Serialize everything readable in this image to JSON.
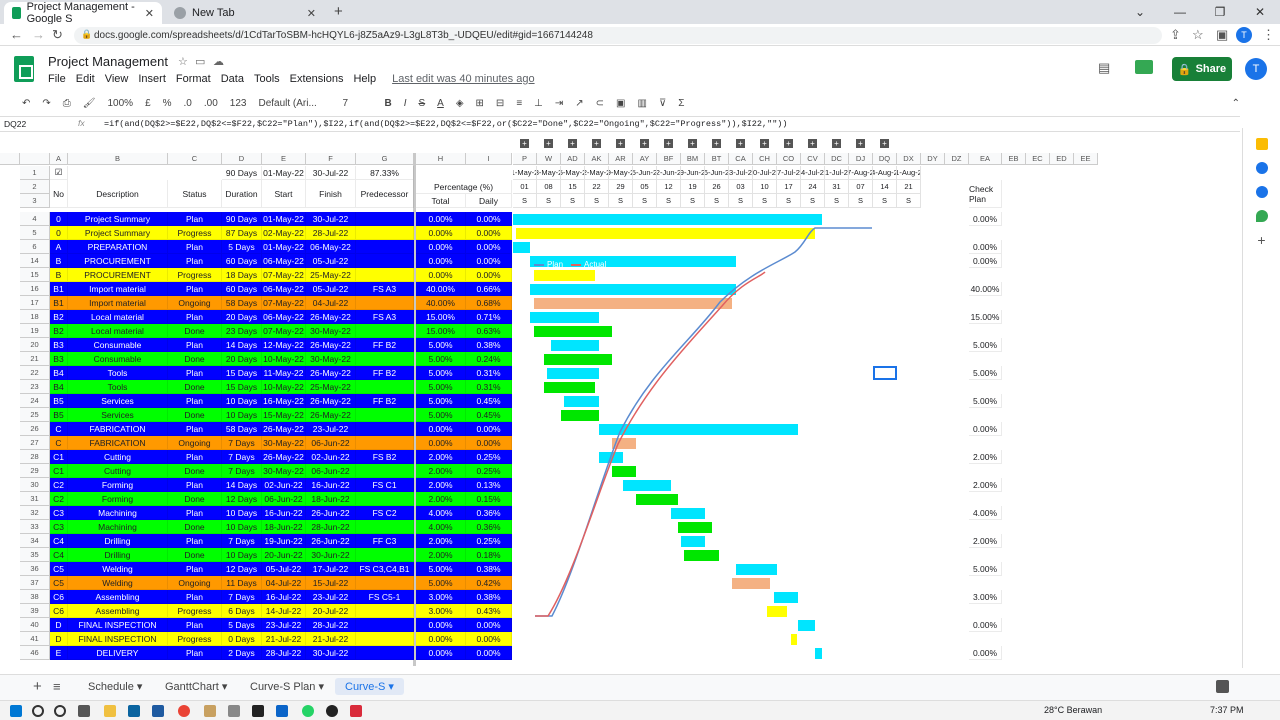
{
  "browser": {
    "tabs": [
      {
        "title": "Project Management - Google S",
        "active": true
      },
      {
        "title": "New Tab",
        "active": false
      }
    ],
    "url": "docs.google.com/spreadsheets/d/1CdTarToSBM-hcHQYL6-j8Z5aAz9-L3gL8T3b_-UDQEU/edit#gid=1667144248"
  },
  "sheet": {
    "title": "Project Management",
    "menu": [
      "File",
      "Edit",
      "View",
      "Insert",
      "Format",
      "Data",
      "Tools",
      "Extensions",
      "Help"
    ],
    "last_edit": "Last edit was 40 minutes ago",
    "share_label": "Share",
    "avatar_letter": "T",
    "toolbar": {
      "zoom": "100%",
      "currency": "£",
      "percent": "%",
      "dec_minus": ".0",
      "dec_plus": ".00",
      "format": "123",
      "font": "Default (Ari...",
      "size": "7"
    },
    "name_box": "DQ22",
    "formula": "=if(and(DQ$2>=$E22,DQ$2<=$F22,$C22=\"Plan\"),$I22,if(and(DQ$2>=$E22,DQ$2<=$F22,or($C22=\"Done\",$C22=\"Ongoing\",$C22=\"Progress\")),$I22,\"\"))"
  },
  "columns": [
    "A",
    "B",
    "C",
    "D",
    "E",
    "F",
    "G",
    "H",
    "I",
    "P",
    "W",
    "AD",
    "AK",
    "AR",
    "AY",
    "BF",
    "BM",
    "BT",
    "CA",
    "CH",
    "CO",
    "CV",
    "DC",
    "DJ",
    "DQ",
    "DX",
    "DY",
    "DZ",
    "EA",
    "EB",
    "EC",
    "ED",
    "EE"
  ],
  "header_rows": {
    "row1": {
      "total_duration": "90 Days",
      "start": "01-May-22",
      "finish": "30-Jul-22",
      "pct": "87.33%"
    },
    "row2": {
      "no": "No",
      "description": "Description",
      "status": "Status",
      "duration": "Duration",
      "start": "Start",
      "finish": "Finish",
      "predecessor": "Predecessor",
      "percentage": "Percentage (%)",
      "check": "Check Plan"
    },
    "row3": {
      "total": "Total",
      "daily": "Daily"
    },
    "timeline_dates": [
      "1-May-2",
      "3-May-2",
      "5-May-2",
      "2-May-2",
      "9-May-2",
      "5-Jun-2",
      "2-Jun-2",
      "9-Jun-2",
      "6-Jun-2",
      "3-Jul-2",
      "0-Jul-2",
      "7-Jul-2",
      "4-Jul-2",
      "1-Jul-2",
      "7-Aug-2",
      "4-Aug-2",
      "1-Aug-2"
    ],
    "timeline_days": [
      "01",
      "08",
      "15",
      "22",
      "29",
      "05",
      "12",
      "19",
      "26",
      "03",
      "10",
      "17",
      "24",
      "31",
      "07",
      "14",
      "21"
    ],
    "timeline_S": "S"
  },
  "rows": [
    {
      "rn": "4",
      "no": "0",
      "desc": "Project Summary",
      "status": "Plan",
      "dur": "90 Days",
      "start": "01-May-22",
      "finish": "30-Jul-22",
      "pred": "",
      "total": "0.00%",
      "daily": "0.00%",
      "check": "0.00%",
      "type": "plan"
    },
    {
      "rn": "5",
      "no": "0",
      "desc": "Project Summary",
      "status": "Progress",
      "dur": "87 Days",
      "start": "02-May-22",
      "finish": "28-Jul-22",
      "pred": "",
      "total": "0.00%",
      "daily": "0.00%",
      "check": "",
      "type": "progress"
    },
    {
      "rn": "6",
      "no": "A",
      "desc": "PREPARATION",
      "status": "Plan",
      "dur": "5 Days",
      "start": "01-May-22",
      "finish": "06-May-22",
      "pred": "",
      "total": "0.00%",
      "daily": "0.00%",
      "check": "0.00%",
      "type": "plan"
    },
    {
      "rn": "14",
      "no": "B",
      "desc": "PROCUREMENT",
      "status": "Plan",
      "dur": "60 Days",
      "start": "06-May-22",
      "finish": "05-Jul-22",
      "pred": "",
      "total": "0.00%",
      "daily": "0.00%",
      "check": "0.00%",
      "type": "plan"
    },
    {
      "rn": "15",
      "no": "B",
      "desc": "PROCUREMENT",
      "status": "Progress",
      "dur": "18 Days",
      "start": "07-May-22",
      "finish": "25-May-22",
      "pred": "",
      "total": "0.00%",
      "daily": "0.00%",
      "check": "",
      "type": "progress"
    },
    {
      "rn": "16",
      "no": "B1",
      "desc": "Import material",
      "status": "Plan",
      "dur": "60 Days",
      "start": "06-May-22",
      "finish": "05-Jul-22",
      "pred": "FS A3",
      "total": "40.00%",
      "daily": "0.66%",
      "check": "40.00%",
      "type": "plan"
    },
    {
      "rn": "17",
      "no": "B1",
      "desc": "Import material",
      "status": "Ongoing",
      "dur": "58 Days",
      "start": "07-May-22",
      "finish": "04-Jul-22",
      "pred": "",
      "total": "40.00%",
      "daily": "0.68%",
      "check": "",
      "type": "ongoing"
    },
    {
      "rn": "18",
      "no": "B2",
      "desc": "Local material",
      "status": "Plan",
      "dur": "20 Days",
      "start": "06-May-22",
      "finish": "26-May-22",
      "pred": "FS A3",
      "total": "15.00%",
      "daily": "0.71%",
      "check": "15.00%",
      "type": "plan"
    },
    {
      "rn": "19",
      "no": "B2",
      "desc": "Local material",
      "status": "Done",
      "dur": "23 Days",
      "start": "07-May-22",
      "finish": "30-May-22",
      "pred": "",
      "total": "15.00%",
      "daily": "0.63%",
      "check": "",
      "type": "done"
    },
    {
      "rn": "20",
      "no": "B3",
      "desc": "Consumable",
      "status": "Plan",
      "dur": "14 Days",
      "start": "12-May-22",
      "finish": "26-May-22",
      "pred": "FF B2",
      "total": "5.00%",
      "daily": "0.38%",
      "check": "5.00%",
      "type": "plan"
    },
    {
      "rn": "21",
      "no": "B3",
      "desc": "Consumable",
      "status": "Done",
      "dur": "20 Days",
      "start": "10-May-22",
      "finish": "30-May-22",
      "pred": "",
      "total": "5.00%",
      "daily": "0.24%",
      "check": "",
      "type": "done"
    },
    {
      "rn": "22",
      "no": "B4",
      "desc": "Tools",
      "status": "Plan",
      "dur": "15 Days",
      "start": "11-May-22",
      "finish": "26-May-22",
      "pred": "FF B2",
      "total": "5.00%",
      "daily": "0.31%",
      "check": "5.00%",
      "type": "plan"
    },
    {
      "rn": "23",
      "no": "B4",
      "desc": "Tools",
      "status": "Done",
      "dur": "15 Days",
      "start": "10-May-22",
      "finish": "25-May-22",
      "pred": "",
      "total": "5.00%",
      "daily": "0.31%",
      "check": "",
      "type": "done"
    },
    {
      "rn": "24",
      "no": "B5",
      "desc": "Services",
      "status": "Plan",
      "dur": "10 Days",
      "start": "16-May-22",
      "finish": "26-May-22",
      "pred": "FF B2",
      "total": "5.00%",
      "daily": "0.45%",
      "check": "5.00%",
      "type": "plan"
    },
    {
      "rn": "25",
      "no": "B5",
      "desc": "Services",
      "status": "Done",
      "dur": "10 Days",
      "start": "15-May-22",
      "finish": "26-May-22",
      "pred": "",
      "total": "5.00%",
      "daily": "0.45%",
      "check": "",
      "type": "done"
    },
    {
      "rn": "26",
      "no": "C",
      "desc": "FABRICATION",
      "status": "Plan",
      "dur": "58 Days",
      "start": "26-May-22",
      "finish": "23-Jul-22",
      "pred": "",
      "total": "0.00%",
      "daily": "0.00%",
      "check": "0.00%",
      "type": "plan"
    },
    {
      "rn": "27",
      "no": "C",
      "desc": "FABRICATION",
      "status": "Ongoing",
      "dur": "7 Days",
      "start": "30-May-22",
      "finish": "06-Jun-22",
      "pred": "",
      "total": "0.00%",
      "daily": "0.00%",
      "check": "",
      "type": "ongoing"
    },
    {
      "rn": "28",
      "no": "C1",
      "desc": "Cutting",
      "status": "Plan",
      "dur": "7 Days",
      "start": "26-May-22",
      "finish": "02-Jun-22",
      "pred": "FS B2",
      "total": "2.00%",
      "daily": "0.25%",
      "check": "2.00%",
      "type": "plan"
    },
    {
      "rn": "29",
      "no": "C1",
      "desc": "Cutting",
      "status": "Done",
      "dur": "7 Days",
      "start": "30-May-22",
      "finish": "06-Jun-22",
      "pred": "",
      "total": "2.00%",
      "daily": "0.25%",
      "check": "",
      "type": "done"
    },
    {
      "rn": "30",
      "no": "C2",
      "desc": "Forming",
      "status": "Plan",
      "dur": "14 Days",
      "start": "02-Jun-22",
      "finish": "16-Jun-22",
      "pred": "FS C1",
      "total": "2.00%",
      "daily": "0.13%",
      "check": "2.00%",
      "type": "plan"
    },
    {
      "rn": "31",
      "no": "C2",
      "desc": "Forming",
      "status": "Done",
      "dur": "12 Days",
      "start": "06-Jun-22",
      "finish": "18-Jun-22",
      "pred": "",
      "total": "2.00%",
      "daily": "0.15%",
      "check": "",
      "type": "done"
    },
    {
      "rn": "32",
      "no": "C3",
      "desc": "Machining",
      "status": "Plan",
      "dur": "10 Days",
      "start": "16-Jun-22",
      "finish": "26-Jun-22",
      "pred": "FS C2",
      "total": "4.00%",
      "daily": "0.36%",
      "check": "4.00%",
      "type": "plan"
    },
    {
      "rn": "33",
      "no": "C3",
      "desc": "Machining",
      "status": "Done",
      "dur": "10 Days",
      "start": "18-Jun-22",
      "finish": "28-Jun-22",
      "pred": "",
      "total": "4.00%",
      "daily": "0.36%",
      "check": "",
      "type": "done"
    },
    {
      "rn": "34",
      "no": "C4",
      "desc": "Drilling",
      "status": "Plan",
      "dur": "7 Days",
      "start": "19-Jun-22",
      "finish": "26-Jun-22",
      "pred": "FF C3",
      "total": "2.00%",
      "daily": "0.25%",
      "check": "2.00%",
      "type": "plan"
    },
    {
      "rn": "35",
      "no": "C4",
      "desc": "Drilling",
      "status": "Done",
      "dur": "10 Days",
      "start": "20-Jun-22",
      "finish": "30-Jun-22",
      "pred": "",
      "total": "2.00%",
      "daily": "0.18%",
      "check": "",
      "type": "done"
    },
    {
      "rn": "36",
      "no": "C5",
      "desc": "Welding",
      "status": "Plan",
      "dur": "12 Days",
      "start": "05-Jul-22",
      "finish": "17-Jul-22",
      "pred": "FS C3,C4,B1",
      "total": "5.00%",
      "daily": "0.38%",
      "check": "5.00%",
      "type": "plan"
    },
    {
      "rn": "37",
      "no": "C5",
      "desc": "Welding",
      "status": "Ongoing",
      "dur": "11 Days",
      "start": "04-Jul-22",
      "finish": "15-Jul-22",
      "pred": "",
      "total": "5.00%",
      "daily": "0.42%",
      "check": "",
      "type": "ongoing"
    },
    {
      "rn": "38",
      "no": "C6",
      "desc": "Assembling",
      "status": "Plan",
      "dur": "7 Days",
      "start": "16-Jul-22",
      "finish": "23-Jul-22",
      "pred": "FS C5-1",
      "total": "3.00%",
      "daily": "0.38%",
      "check": "3.00%",
      "type": "plan"
    },
    {
      "rn": "39",
      "no": "C6",
      "desc": "Assembling",
      "status": "Progress",
      "dur": "6 Days",
      "start": "14-Jul-22",
      "finish": "20-Jul-22",
      "pred": "",
      "total": "3.00%",
      "daily": "0.43%",
      "check": "",
      "type": "progress"
    },
    {
      "rn": "40",
      "no": "D",
      "desc": "FINAL INSPECTION",
      "status": "Plan",
      "dur": "5 Days",
      "start": "23-Jul-22",
      "finish": "28-Jul-22",
      "pred": "",
      "total": "0.00%",
      "daily": "0.00%",
      "check": "0.00%",
      "type": "plan"
    },
    {
      "rn": "41",
      "no": "D",
      "desc": "FINAL INSPECTION",
      "status": "Progress",
      "dur": "0 Days",
      "start": "21-Jul-22",
      "finish": "21-Jul-22",
      "pred": "",
      "total": "0.00%",
      "daily": "0.00%",
      "check": "",
      "type": "progress"
    },
    {
      "rn": "46",
      "no": "E",
      "desc": "DELIVERY",
      "status": "Plan",
      "dur": "2 Days",
      "start": "28-Jul-22",
      "finish": "30-Jul-22",
      "pred": "",
      "total": "0.00%",
      "daily": "0.00%",
      "check": "0.00%",
      "type": "plan"
    }
  ],
  "chart_legend": {
    "plan": "Plan",
    "actual": "Actual"
  },
  "sheet_tabs": [
    "Schedule",
    "GanttChart",
    "Curve-S Plan",
    "Curve-S"
  ],
  "active_sheet": "Curve-S",
  "taskbar": {
    "weather": "28°C Berawan",
    "time": "7:37 PM"
  },
  "colors": {
    "plan": "#0000ff",
    "progress": "#ffff00",
    "ongoing": "#ff9900",
    "done": "#00ff00",
    "bar_cyan": "#00e5ff",
    "bar_orange": "#f4b183"
  }
}
